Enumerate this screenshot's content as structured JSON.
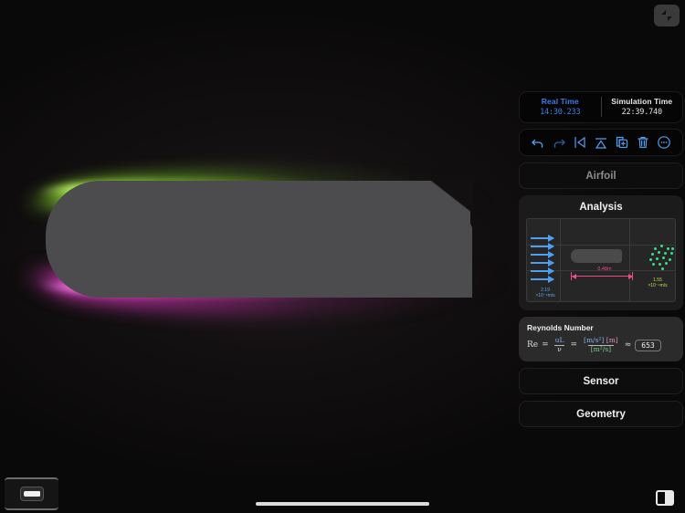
{
  "window": {
    "collapse_icon": "collapse-arrows-icon"
  },
  "timebar": {
    "real_label": "Real Time",
    "real_value": "14:30.233",
    "sim_label": "Simulation Time",
    "sim_value": "22:39.740"
  },
  "toolbar": {
    "items": [
      {
        "name": "undo-icon",
        "label": "Undo"
      },
      {
        "name": "redo-icon",
        "label": "Redo"
      },
      {
        "name": "flip-horizontal-icon",
        "label": "Flip Horizontal"
      },
      {
        "name": "flip-vertical-icon",
        "label": "Flip Vertical"
      },
      {
        "name": "duplicate-icon",
        "label": "Duplicate"
      },
      {
        "name": "trash-icon",
        "label": "Delete"
      },
      {
        "name": "more-options-icon",
        "label": "More"
      }
    ]
  },
  "sections": {
    "airfoil": "Airfoil",
    "analysis": "Analysis",
    "sensor": "Sensor",
    "geometry": "Geometry"
  },
  "analysis": {
    "inflow_label_value": "2.19",
    "inflow_label_unit": "×10⁻⁴m/s",
    "outflow_label_value": "1.55",
    "outflow_label_unit": "×10⁻⁴m/s",
    "dimension_label": "0.48m"
  },
  "reynolds": {
    "title": "Reynolds Number",
    "symbol": "Re",
    "eq1": "=",
    "num1": "uL",
    "den1": "ν",
    "eq2": "=",
    "num2_a": "[m/s²]",
    "num2_b": "[m]",
    "den2": "[m²/s]",
    "approx": "≈",
    "value": "653"
  },
  "bottom": {
    "thumbnail_name": "airfoil-thumbnail",
    "home_indicator": "home-indicator",
    "panel_toggle_icon": "panel-toggle-icon"
  },
  "colors": {
    "accent_blue": "#3b7fe8",
    "flow_green": "#3bdc8c",
    "dimension_pink": "#ef4a8b",
    "glow_top": "#96e632",
    "glow_bottom": "#e13cc3"
  },
  "chart_data": {
    "type": "scatter",
    "title": "Analysis",
    "xlabel": "",
    "ylabel": "",
    "annotations": [
      {
        "text": "2.19 ×10⁻⁴m/s",
        "role": "inlet-velocity"
      },
      {
        "text": "1.55 ×10⁻⁴m/s",
        "role": "outlet-velocity"
      },
      {
        "text": "0.48m",
        "role": "chord-length"
      }
    ],
    "series": [
      {
        "name": "inflow-arrows",
        "count": 6,
        "color": "#4f9ff0"
      },
      {
        "name": "wake-particles",
        "count": 16,
        "color": "#3bdc8c"
      }
    ]
  }
}
